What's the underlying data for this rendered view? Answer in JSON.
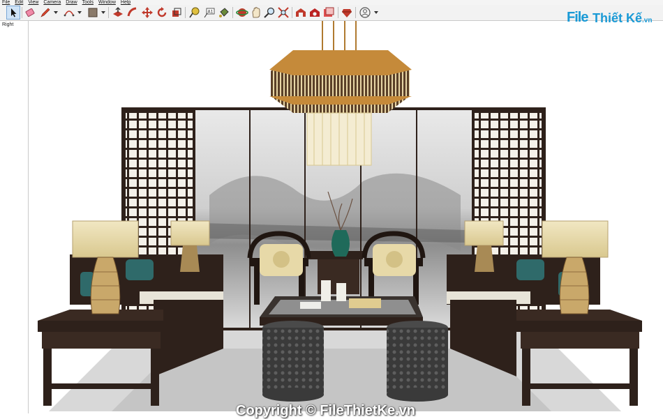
{
  "menu": [
    "File",
    "Edit",
    "View",
    "Camera",
    "Draw",
    "Tools",
    "Window",
    "Help"
  ],
  "toolbar": {
    "tools": [
      "select-icon",
      "eraser-icon",
      "pencil-icon",
      "arc-icon",
      "shape-icon",
      "push-pull-icon",
      "follow-me-icon",
      "move-icon",
      "rotate-icon",
      "scale-icon",
      "tape-measure-icon",
      "text-icon",
      "paint-bucket-icon",
      "orbit-icon",
      "pan-icon",
      "zoom-icon",
      "zoom-extents-icon",
      "warehouse-icon",
      "extension-warehouse-icon",
      "layout-icon",
      "ruby-icon",
      "account-icon"
    ]
  },
  "viewport": {
    "view_label": "Right"
  },
  "logo": {
    "file": "File",
    "name": "Thiết Kế",
    "tld": ".vn"
  },
  "watermark": "Copyright © FileThietKe.vn",
  "colors": {
    "wood": "#2e211b",
    "cushion": "#e7d9a8",
    "teal": "#2f6a6a",
    "lamp": "#e9dcae",
    "gold": "#c79a45"
  }
}
